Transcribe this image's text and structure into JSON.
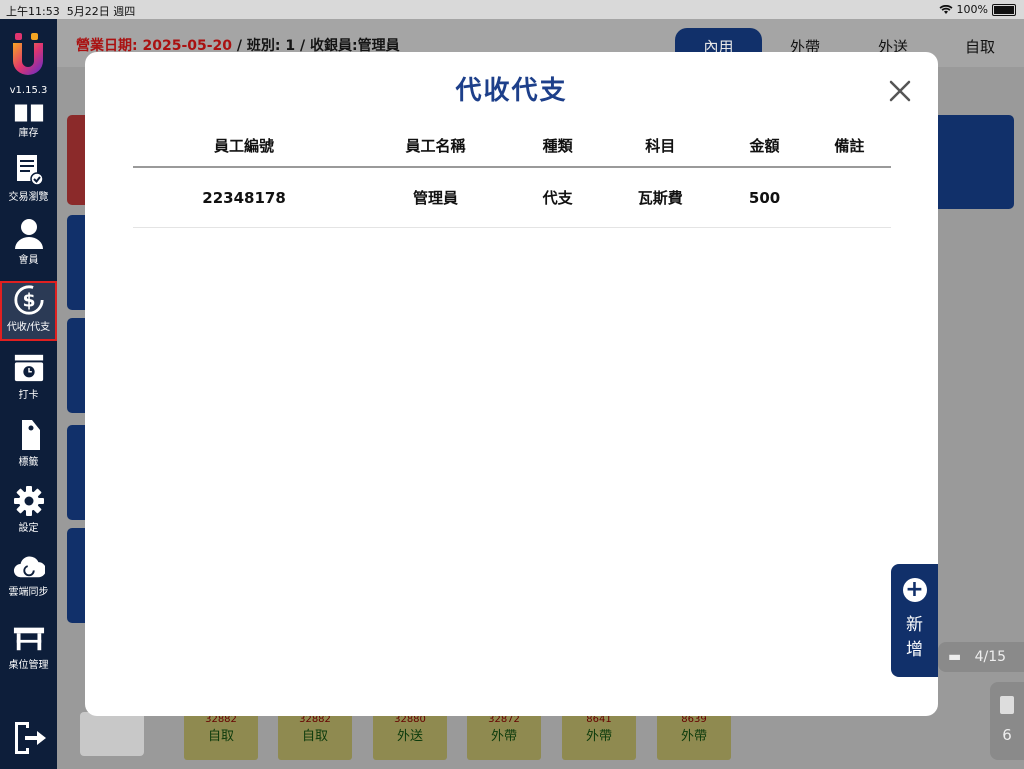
{
  "status_bar": {
    "time": "上午11:53",
    "date": "5月22日 週四",
    "battery": "100%"
  },
  "app": {
    "version": "v1.15.3"
  },
  "sidebar": {
    "items": [
      {
        "label": "庫存",
        "icon": "book-icon"
      },
      {
        "label": "交易瀏覽",
        "icon": "receipt-check-icon"
      },
      {
        "label": "會員",
        "icon": "person-icon"
      },
      {
        "label": "代收/代支",
        "icon": "dollar-cycle-icon"
      },
      {
        "label": "打卡",
        "icon": "punch-clock-icon"
      },
      {
        "label": "標籤",
        "icon": "tag-icon"
      },
      {
        "label": "設定",
        "icon": "gear-icon"
      },
      {
        "label": "雲端同步",
        "icon": "cloud-sync-icon"
      },
      {
        "label": "桌位管理",
        "icon": "table-icon"
      }
    ]
  },
  "header": {
    "date_label": "營業日期:",
    "date_value": "2025-05-20",
    "shift_info": "/ 班別: 1 / 收銀員:管理員"
  },
  "order_tabs": [
    "內用",
    "外帶",
    "外送",
    "自取"
  ],
  "bg_tickets": [
    {
      "num": "32882",
      "type": "自取"
    },
    {
      "num": "32882",
      "type": "自取"
    },
    {
      "num": "32880",
      "type": "外送"
    },
    {
      "num": "32872",
      "type": "外帶"
    },
    {
      "num": "8641",
      "type": "外帶"
    },
    {
      "num": "8639",
      "type": "外帶"
    }
  ],
  "table_count": "4/15",
  "order_count": "6",
  "modal": {
    "title": "代收代支",
    "columns": [
      "員工編號",
      "員工名稱",
      "種類",
      "科目",
      "金額",
      "備註"
    ],
    "rows": [
      [
        "22348178",
        "管理員",
        "代支",
        "瓦斯費",
        "500",
        ""
      ]
    ],
    "add_label_1": "新",
    "add_label_2": "增"
  }
}
